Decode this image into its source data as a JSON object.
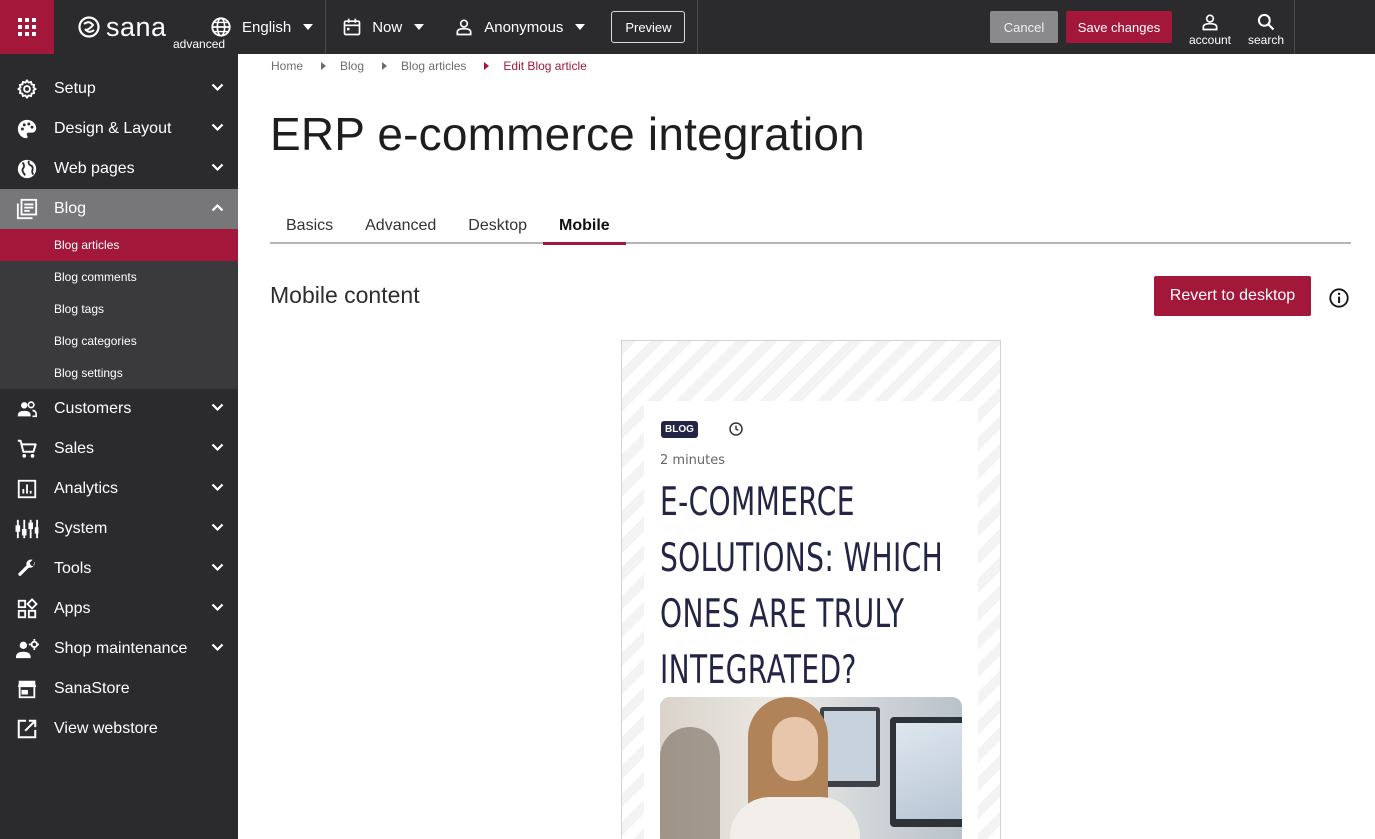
{
  "topbar": {
    "logo_text": "sana",
    "logo_sub": "advanced",
    "language": "English",
    "date": "Now",
    "user": "Anonymous",
    "preview_label": "Preview",
    "cancel_label": "Cancel",
    "save_label": "Save changes",
    "account_label": "account",
    "search_label": "search"
  },
  "sidebar": {
    "items": [
      {
        "label": "Setup",
        "icon": "gear-icon"
      },
      {
        "label": "Design & Layout",
        "icon": "palette-icon"
      },
      {
        "label": "Web pages",
        "icon": "globe-icon"
      },
      {
        "label": "Blog",
        "icon": "blog-icon"
      },
      {
        "label": "Customers",
        "icon": "people-icon"
      },
      {
        "label": "Sales",
        "icon": "cart-icon"
      },
      {
        "label": "Analytics",
        "icon": "chart-icon"
      },
      {
        "label": "System",
        "icon": "sliders-icon"
      },
      {
        "label": "Tools",
        "icon": "wrench-icon"
      },
      {
        "label": "Apps",
        "icon": "apps-icon"
      },
      {
        "label": "Shop maintenance",
        "icon": "maintenance-icon"
      },
      {
        "label": "SanaStore",
        "icon": "store-icon"
      },
      {
        "label": "View webstore",
        "icon": "external-link-icon"
      }
    ],
    "blog_sub": [
      "Blog articles",
      "Blog comments",
      "Blog tags",
      "Blog categories",
      "Blog settings"
    ]
  },
  "breadcrumb": [
    "Home",
    "Blog",
    "Blog articles",
    "Edit Blog article"
  ],
  "page_title": "ERP e-commerce integration",
  "tabs": [
    "Basics",
    "Advanced",
    "Desktop",
    "Mobile"
  ],
  "section": {
    "title": "Mobile content",
    "revert_label": "Revert to desktop"
  },
  "preview": {
    "badge": "BLOG",
    "read_time": "2 minutes",
    "title_lines": [
      "E-COMMERCE",
      "SOLUTIONS: WHICH",
      "ONES ARE TRULY",
      "INTEGRATED?"
    ]
  },
  "colors": {
    "brand": "#a3173a",
    "dark": "#2b2b2d",
    "navy": "#222545"
  }
}
